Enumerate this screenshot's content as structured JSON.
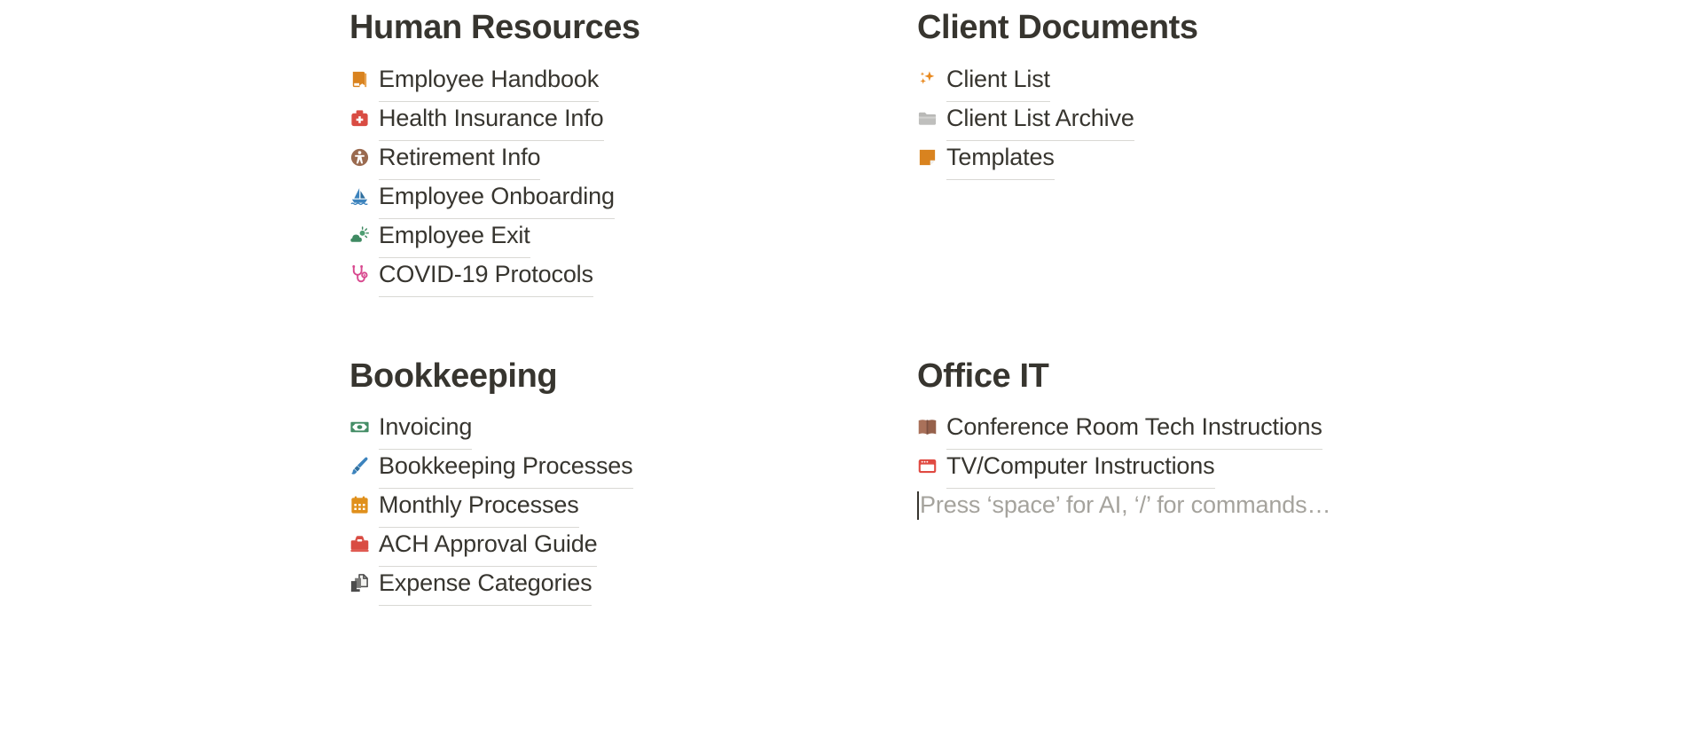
{
  "document": {
    "background_color": "#ffffff",
    "text_color": "#37352f",
    "underline_color": "#d9d8d4",
    "placeholder_color": "#a5a39d"
  },
  "columns": {
    "human_resources": {
      "heading": "Human Resources",
      "items": [
        {
          "label": "Employee Handbook",
          "icon": "closed-book-icon",
          "icon_color": "#d9831f"
        },
        {
          "label": "Health Insurance Info",
          "icon": "medical-bag-icon",
          "icon_color": "#d94c43"
        },
        {
          "label": "Retirement Info",
          "icon": "accessibility-person-icon",
          "icon_color": "#9a6a4f"
        },
        {
          "label": "Employee Onboarding",
          "icon": "sailboat-icon",
          "icon_color": "#3c83bd"
        },
        {
          "label": "Employee Exit",
          "icon": "sun-behind-cloud-icon",
          "icon_color": "#3f8a62"
        },
        {
          "label": "COVID-19 Protocols",
          "icon": "stethoscope-icon",
          "icon_color": "#d8498f"
        }
      ]
    },
    "client_documents": {
      "heading": "Client Documents",
      "items": [
        {
          "label": "Client List",
          "icon": "sparkles-icon",
          "icon_color": "#e8891f"
        },
        {
          "label": "Client List Archive",
          "icon": "folder-icon",
          "icon_color": "#aeaeae"
        },
        {
          "label": "Templates",
          "icon": "sticky-note-icon",
          "icon_color": "#d9831f"
        }
      ]
    },
    "bookkeeping": {
      "heading": "Bookkeeping",
      "items": [
        {
          "label": "Invoicing",
          "icon": "banknote-icon",
          "icon_color": "#3f8a62"
        },
        {
          "label": "Bookkeeping Processes",
          "icon": "paintbrush-icon",
          "icon_color": "#3c83bd"
        },
        {
          "label": "Monthly Processes",
          "icon": "calendar-icon",
          "icon_color": "#e0901c"
        },
        {
          "label": "ACH Approval Guide",
          "icon": "toolbox-icon",
          "icon_color": "#d94c43"
        },
        {
          "label": "Expense Categories",
          "icon": "file-folders-icon",
          "icon_color": "#4c4c4c"
        }
      ]
    },
    "office_it": {
      "heading": "Office IT",
      "items": [
        {
          "label": "Conference Room Tech Instructions",
          "icon": "open-book-icon",
          "icon_color": "#a9715a"
        },
        {
          "label": "TV/Computer Instructions",
          "icon": "browser-window-icon",
          "icon_color": "#e04a42"
        }
      ],
      "empty_block_placeholder": "Press ‘space’ for AI, ‘/’ for commands…"
    }
  }
}
